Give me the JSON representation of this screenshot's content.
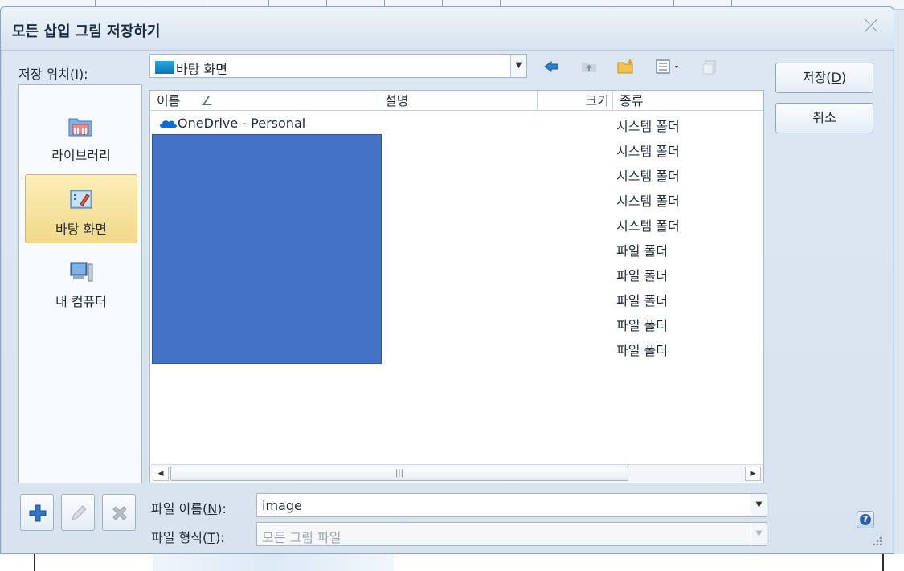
{
  "window": {
    "title": "모든 삽입 그림 저장하기",
    "close_icon": "close-icon"
  },
  "location": {
    "label_prefix": "저장 위치(",
    "label_key": "I",
    "label_suffix": "):",
    "value": "바탕 화면",
    "value_icon": "desktop-icon"
  },
  "toolbar": {
    "icons": [
      "back-arrow-icon",
      "up-folder-icon",
      "new-folder-icon",
      "view-menu-icon",
      "copy-icon"
    ]
  },
  "buttons": {
    "save_prefix": "저장(",
    "save_key": "D",
    "save_suffix": ")",
    "cancel": "취소"
  },
  "places": [
    {
      "label": "라이브러리",
      "icon": "library-icon",
      "selected": false
    },
    {
      "label": "바탕 화면",
      "icon": "desktop-icon",
      "selected": true
    },
    {
      "label": "내 컴퓨터",
      "icon": "computer-icon",
      "selected": false
    }
  ],
  "filelist": {
    "columns": [
      "이름",
      "설명",
      "크기",
      "종류"
    ],
    "sort_indicator": "∠",
    "rows": [
      {
        "name": "OneDrive - Personal",
        "type": "시스템 폴더",
        "icon": "onedrive-cloud-icon"
      },
      {
        "name": "",
        "type": "시스템 폴더"
      },
      {
        "name": "",
        "type": "시스템 폴더"
      },
      {
        "name": "",
        "type": "시스템 폴더"
      },
      {
        "name": "",
        "type": "시스템 폴더"
      },
      {
        "name": "",
        "type": "파일 폴더"
      },
      {
        "name": "",
        "type": "파일 폴더"
      },
      {
        "name": "",
        "type": "파일 폴더"
      },
      {
        "name": "",
        "type": "파일 폴더"
      },
      {
        "name": "",
        "type": "파일 폴더"
      }
    ]
  },
  "filename": {
    "label_prefix": "파일 이름(",
    "label_key": "N",
    "label_suffix": "):",
    "value": "image"
  },
  "filetype": {
    "label_prefix": "파일 형식(",
    "label_key": "T",
    "label_suffix": "):",
    "value": "모든 그림 파일"
  },
  "list_actions": [
    "add-icon",
    "edit-pencil-icon",
    "delete-x-icon"
  ],
  "colors": {
    "selection": "#f2d98a",
    "redaction": "#4472c4",
    "onedrive": "#0a6cd6"
  }
}
